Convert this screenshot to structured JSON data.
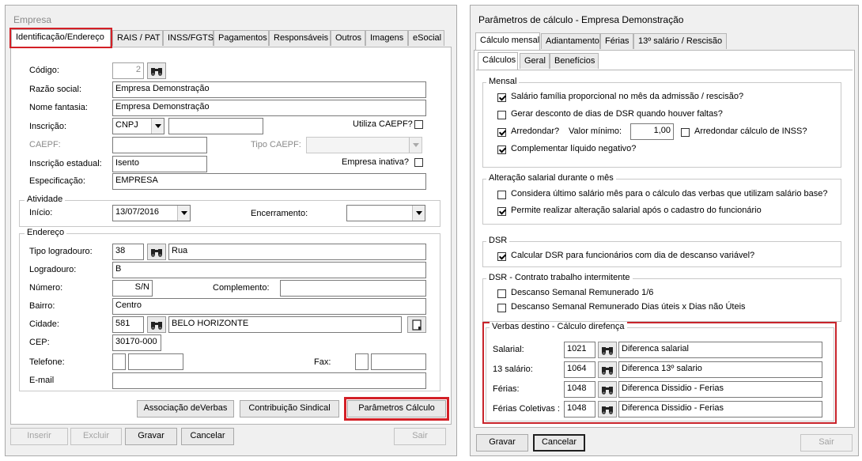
{
  "left_window": {
    "title": "Empresa",
    "tabs": [
      "Identificação/Endereço",
      "RAIS / PAT",
      "INSS/FGTS",
      "Pagamentos",
      "Responsáveis",
      "Outros",
      "Imagens",
      "eSocial"
    ],
    "fields": {
      "codigo": {
        "label": "Código:",
        "value": "2"
      },
      "razao_social": {
        "label": "Razão social:",
        "value": "Empresa Demonstração"
      },
      "nome_fantasia": {
        "label": "Nome fantasia:",
        "value": "Empresa Demonstração"
      },
      "inscricao": {
        "label": "Inscrição:",
        "type_value": "CNPJ",
        "value": ""
      },
      "utiliza_caepf": {
        "label": "Utiliza CAEPF?",
        "checked": false
      },
      "caepf": {
        "label": "CAEPF:",
        "value": ""
      },
      "tipo_caepf": {
        "label": "Tipo CAEPF:",
        "value": ""
      },
      "inscricao_estadual": {
        "label": "Inscrição estadual:",
        "value": "Isento"
      },
      "empresa_inativa": {
        "label": "Empresa inativa?",
        "checked": false
      },
      "especificacao": {
        "label": "Especificação:",
        "value": "EMPRESA"
      }
    },
    "atividade": {
      "title": "Atividade",
      "inicio_label": "Início:",
      "inicio_value": "13/07/2016",
      "encerramento_label": "Encerramento:",
      "encerramento_value": ""
    },
    "endereco": {
      "title": "Endereço",
      "tipo_logradouro_label": "Tipo logradouro:",
      "tipo_logradouro_code": "38",
      "tipo_logradouro_name": "Rua",
      "logradouro_label": "Logradouro:",
      "logradouro_value": "B",
      "numero_label": "Número:",
      "numero_value": "S/N",
      "complemento_label": "Complemento:",
      "complemento_value": "",
      "bairro_label": "Bairro:",
      "bairro_value": "Centro",
      "cidade_label": "Cidade:",
      "cidade_code": "581",
      "cidade_name": "BELO HORIZONTE",
      "cep_label": "CEP:",
      "cep_value": "30170-000",
      "telefone_label": "Telefone:",
      "fax_label": "Fax:",
      "email_label": "E-mail",
      "email_value": ""
    },
    "action_buttons": {
      "associacao": "Associação deVerbas",
      "contribuicao": "Contribuição Sindical",
      "parametros": "Parâmetros Cálculo"
    },
    "footer_buttons": {
      "inserir": "Inserir",
      "excluir": "Excluir",
      "gravar": "Gravar",
      "cancelar": "Cancelar",
      "sair": "Sair"
    }
  },
  "right_window": {
    "title": "Parâmetros de cálculo  - Empresa Demonstração",
    "tabs": [
      "Cálculo mensal",
      "Adiantamento",
      "Férias",
      "13º salário / Rescisão"
    ],
    "subtabs": [
      "Cálculos",
      "Geral",
      "Benefícios"
    ],
    "mensal": {
      "title": "Mensal",
      "opt1": {
        "label": "Salário família proporcional no mês da admissão / rescisão?",
        "checked": true
      },
      "opt2": {
        "label": "Gerar desconto de dias de DSR quando houver faltas?",
        "checked": false
      },
      "opt3": {
        "label": "Arredondar?",
        "checked": true
      },
      "valor_minimo_label": "Valor mínimo:",
      "valor_minimo_value": "1,00",
      "opt4": {
        "label": "Arredondar cálculo de INSS?",
        "checked": false
      },
      "opt5": {
        "label": "Complementar líquido negativo?",
        "checked": true
      }
    },
    "alteracao": {
      "title": "Alteração salarial durante o mês",
      "opt1": {
        "label": "Considera último salário mês para o cálculo das verbas que utilizam salário base?",
        "checked": false
      },
      "opt2": {
        "label": "Permite realizar alteração salarial após o cadastro do funcionário",
        "checked": true
      }
    },
    "dsr": {
      "title": "DSR",
      "opt1": {
        "label": "Calcular DSR para funcionários com dia de descanso variável?",
        "checked": true
      }
    },
    "dsr_intermitente": {
      "title": "DSR - Contrato trabalho intermitente",
      "opt1": {
        "label": "Descanso Semanal Remunerado 1/6",
        "checked": false
      },
      "opt2": {
        "label": "Descanso Semanal Remunerado Dias úteis x Dias não Úteis",
        "checked": false
      }
    },
    "verbas": {
      "title": "Verbas destino - Cálculo direfença",
      "rows": [
        {
          "label": "Salarial:",
          "code": "1021",
          "name": "Diferenca salarial"
        },
        {
          "label": "13 salário:",
          "code": "1064",
          "name": "Diferenca 13º salario"
        },
        {
          "label": "Férias:",
          "code": "1048",
          "name": "Diferenca Dissidio - Ferias"
        },
        {
          "label": "Férias Coletivas :",
          "code": "1048",
          "name": "Diferenca Dissidio - Ferias"
        }
      ]
    },
    "footer_buttons": {
      "gravar": "Gravar",
      "cancelar": "Cancelar",
      "sair": "Sair"
    }
  },
  "colors": {
    "highlight_red": "#d32027",
    "panel_bg": "#f0f0f0"
  },
  "icons": {
    "lookup": "binoculars-icon",
    "city_lookup": "document-icon"
  }
}
